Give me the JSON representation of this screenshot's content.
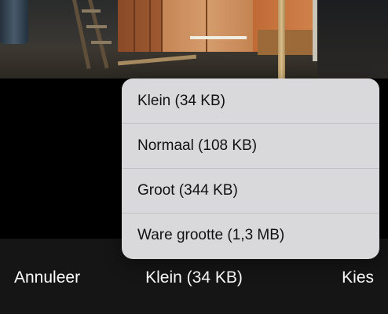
{
  "menu": {
    "items": [
      {
        "label": "Klein (34 KB)"
      },
      {
        "label": "Normaal (108 KB)"
      },
      {
        "label": "Groot (344 KB)"
      },
      {
        "label": "Ware grootte (1,3 MB)"
      }
    ]
  },
  "toolbar": {
    "cancel_label": "Annuleer",
    "selected_size": "Klein (34 KB)",
    "choose_label": "Kies"
  },
  "colors": {
    "toolbar_background": "#151515",
    "menu_background": "#e2e2e5",
    "text_light": "#ffffff",
    "text_dark": "#111111"
  }
}
